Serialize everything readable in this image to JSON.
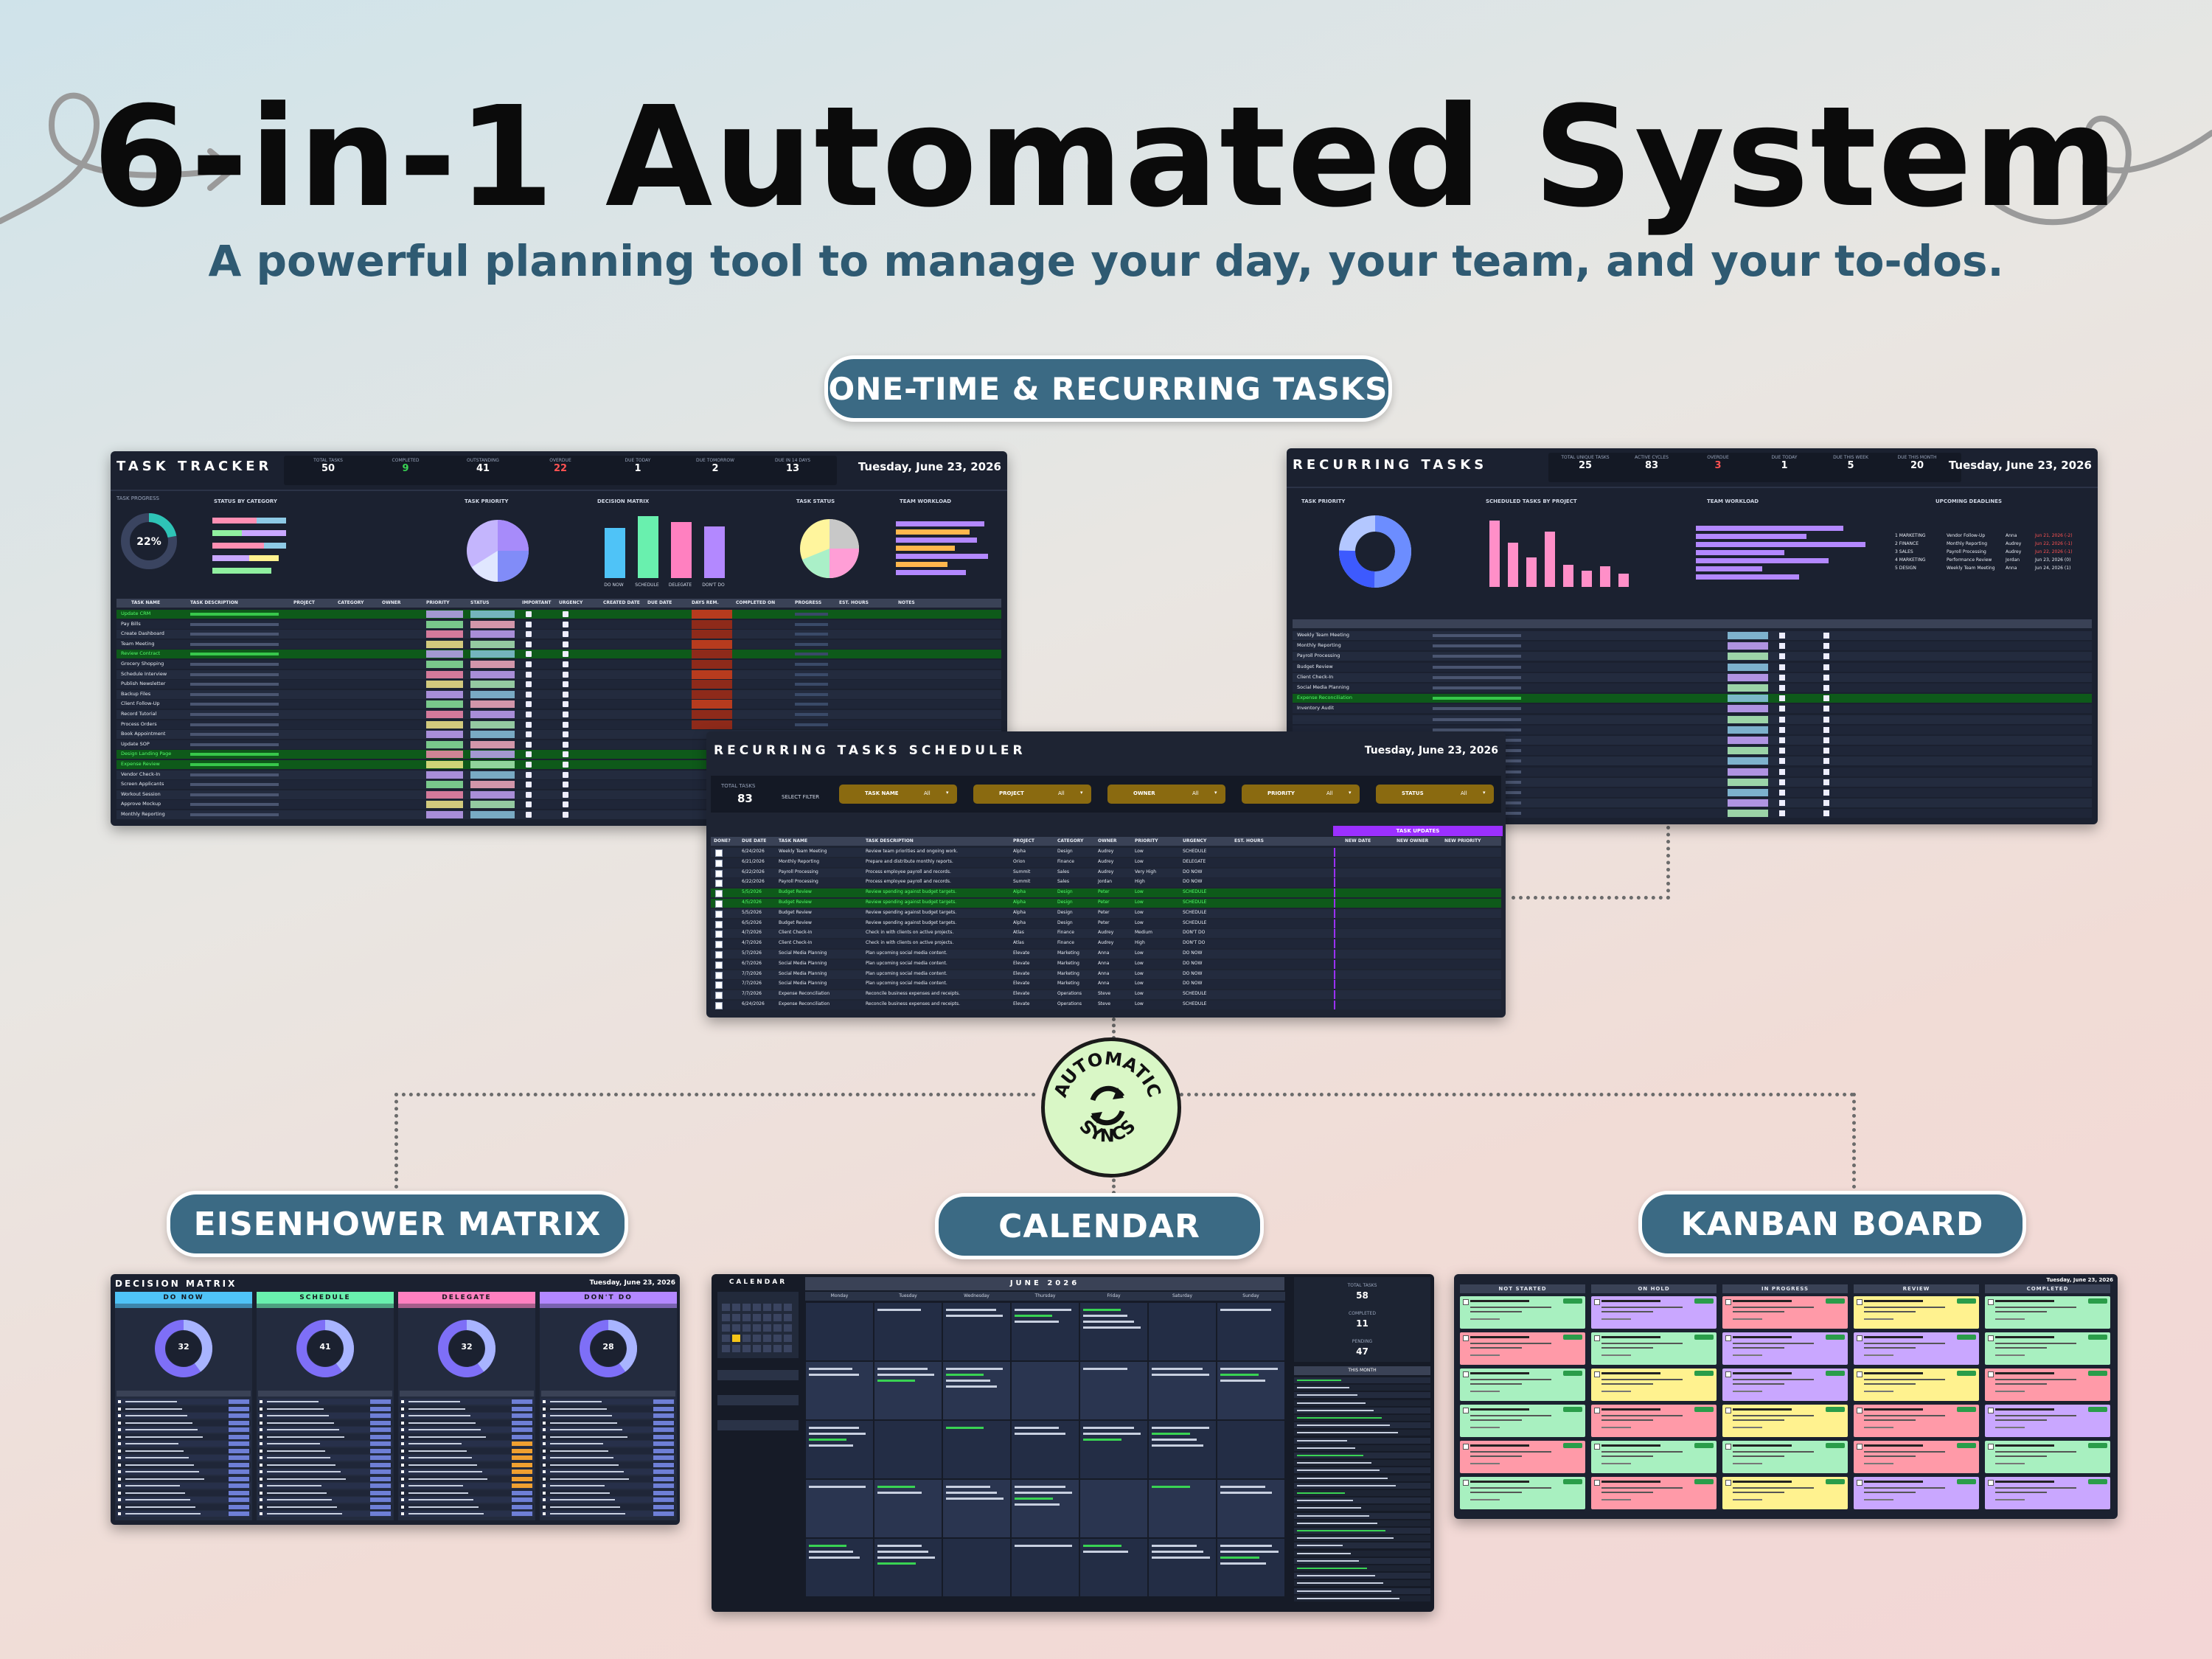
{
  "header": {
    "title": "6-in-1 Automated System",
    "subtitle": "A powerful planning tool to manage your day, your team, and your to-dos."
  },
  "sections": {
    "tasks_pill": "ONE-TIME & RECURRING TASKS",
    "eisenhower_pill": "EISENHOWER MATRIX",
    "calendar_pill": "CALENDAR",
    "kanban_pill": "KANBAN BOARD",
    "sync_badge_top": "AUTOMATIC",
    "sync_badge_bottom": "SYNCS"
  },
  "task_tracker": {
    "title": "TASK TRACKER",
    "date": "Tuesday, June 23, 2026",
    "stats": [
      {
        "label": "TOTAL TASKS",
        "value": "50"
      },
      {
        "label": "COMPLETED",
        "value": "9"
      },
      {
        "label": "OUTSTANDING",
        "value": "41"
      },
      {
        "label": "OVERDUE",
        "value": "22"
      },
      {
        "label": "DUE TODAY",
        "value": "1"
      },
      {
        "label": "DUE TOMORROW",
        "value": "2"
      },
      {
        "label": "DUE IN 14 DAYS",
        "value": "13"
      }
    ],
    "progress_label": "TASK PROGRESS",
    "progress_value": "22%",
    "chart_labels": [
      "STATUS BY CATEGORY",
      "TASK PRIORITY",
      "DECISION MATRIX",
      "TASK STATUS",
      "TEAM WORKLOAD"
    ],
    "matrix_bars": [
      "DO NOW",
      "SCHEDULE",
      "DELEGATE",
      "DON'T DO"
    ],
    "table_headers": [
      "TASK NAME",
      "TASK DESCRIPTION",
      "PROJECT",
      "CATEGORY",
      "OWNER",
      "PRIORITY",
      "STATUS",
      "IMPORTANT",
      "URGENCY",
      "CREATED DATE",
      "DUE DATE",
      "DAYS REM.",
      "COMPLETED ON",
      "PROGRESS",
      "EST. HOURS",
      "NOTES"
    ],
    "rows": [
      "Update CRM",
      "Pay Bills",
      "Create Dashboard",
      "Team Meeting",
      "Review Contract",
      "Grocery Shopping",
      "Schedule Interview",
      "Publish Newsletter",
      "Backup Files",
      "Client Follow-Up",
      "Record Tutorial",
      "Process Orders",
      "Book Appointment",
      "Update SOP",
      "Design Landing Page",
      "Expense Review",
      "Vendor Check-In",
      "Screen Applicants",
      "Workout Session",
      "Approve Mockup",
      "Monthly Reporting"
    ]
  },
  "recurring": {
    "title": "RECURRING TASKS",
    "date": "Tuesday, June 23, 2026",
    "stats": [
      {
        "label": "TOTAL UNIQUE TASKS",
        "value": "25"
      },
      {
        "label": "ACTIVE CYCLES",
        "value": "83"
      },
      {
        "label": "OVERDUE",
        "value": "3"
      },
      {
        "label": "DUE TODAY",
        "value": "1"
      },
      {
        "label": "DUE THIS WEEK",
        "value": "5"
      },
      {
        "label": "DUE THIS MONTH",
        "value": "20"
      }
    ],
    "chart_labels": [
      "TASK PRIORITY",
      "SCHEDULED TASKS BY PROJECT",
      "TEAM WORKLOAD",
      "UPCOMING DEADLINES"
    ],
    "deadlines": [
      {
        "cat": "1 MARKETING",
        "task": "Vendor Follow-Up",
        "owner": "Anna",
        "due": "Jun 21, 2026 (-2)"
      },
      {
        "cat": "2 FINANCE",
        "task": "Monthly Reporting",
        "owner": "Audrey",
        "due": "Jun 22, 2026 (-1)"
      },
      {
        "cat": "3 SALES",
        "task": "Payroll Processing",
        "owner": "Audrey",
        "due": "Jun 22, 2026 (-1)"
      },
      {
        "cat": "4 MARKETING",
        "task": "Performance Review",
        "owner": "Jordan",
        "due": "Jun 23, 2026 (0)"
      },
      {
        "cat": "5 DESIGN",
        "task": "Weekly Team Meeting",
        "owner": "Anna",
        "due": "Jun 24, 2026 (1)"
      }
    ],
    "rows": [
      "Weekly Team Meeting",
      "Monthly Reporting",
      "Payroll Processing",
      "Budget Review",
      "Client Check-In",
      "Social Media Planning",
      "Expense Reconciliation",
      "Inventory Audit"
    ]
  },
  "scheduler": {
    "title": "RECURRING TASKS SCHEDULER",
    "date": "Tuesday, June 23, 2026",
    "total_label": "TOTAL TASKS",
    "total_value": "83",
    "filter_label": "SELECT FILTER",
    "filters": [
      "TASK NAME",
      "PROJECT",
      "OWNER",
      "PRIORITY",
      "STATUS"
    ],
    "filter_value": "All",
    "task_updates": "TASK UPDATES",
    "headers": [
      "DONE?",
      "DUE DATE",
      "TASK NAME",
      "TASK DESCRIPTION",
      "PROJECT",
      "CATEGORY",
      "OWNER",
      "PRIORITY",
      "URGENCY",
      "EST. HOURS",
      "NEW DATE",
      "NEW OWNER",
      "NEW PRIORITY"
    ],
    "rows": [
      {
        "date": "6/24/2026",
        "task": "Weekly Team Meeting",
        "desc": "Review team priorities and ongoing work.",
        "proj": "Alpha",
        "cat": "Design",
        "owner": "Audrey",
        "pri": "Low",
        "urg": "SCHEDULE"
      },
      {
        "date": "6/21/2026",
        "task": "Monthly Reporting",
        "desc": "Prepare and distribute monthly reports.",
        "proj": "Orion",
        "cat": "Finance",
        "owner": "Audrey",
        "pri": "Low",
        "urg": "DELEGATE"
      },
      {
        "date": "6/22/2026",
        "task": "Payroll Processing",
        "desc": "Process employee payroll and records.",
        "proj": "Summit",
        "cat": "Sales",
        "owner": "Audrey",
        "pri": "Very High",
        "urg": "DO NOW"
      },
      {
        "date": "6/22/2026",
        "task": "Payroll Processing",
        "desc": "Process employee payroll and records.",
        "proj": "Summit",
        "cat": "Sales",
        "owner": "Jordan",
        "pri": "High",
        "urg": "DO NOW"
      },
      {
        "date": "5/5/2026",
        "task": "Budget Review",
        "desc": "Review spending against budget targets.",
        "proj": "Alpha",
        "cat": "Design",
        "owner": "Peter",
        "pri": "Low",
        "urg": "SCHEDULE"
      },
      {
        "date": "4/5/2026",
        "task": "Budget Review",
        "desc": "Review spending against budget targets.",
        "proj": "Alpha",
        "cat": "Design",
        "owner": "Peter",
        "pri": "Low",
        "urg": "SCHEDULE"
      },
      {
        "date": "5/5/2026",
        "task": "Budget Review",
        "desc": "Review spending against budget targets.",
        "proj": "Alpha",
        "cat": "Design",
        "owner": "Peter",
        "pri": "Low",
        "urg": "SCHEDULE"
      },
      {
        "date": "6/5/2026",
        "task": "Budget Review",
        "desc": "Review spending against budget targets.",
        "proj": "Alpha",
        "cat": "Design",
        "owner": "Peter",
        "pri": "Low",
        "urg": "SCHEDULE"
      },
      {
        "date": "4/7/2026",
        "task": "Client Check-In",
        "desc": "Check in with clients on active projects.",
        "proj": "Atlas",
        "cat": "Finance",
        "owner": "Audrey",
        "pri": "Medium",
        "urg": "DON'T DO"
      },
      {
        "date": "4/7/2026",
        "task": "Client Check-In",
        "desc": "Check in with clients on active projects.",
        "proj": "Atlas",
        "cat": "Finance",
        "owner": "Audrey",
        "pri": "High",
        "urg": "DON'T DO"
      },
      {
        "date": "5/7/2026",
        "task": "Social Media Planning",
        "desc": "Plan upcoming social media content.",
        "proj": "Elevate",
        "cat": "Marketing",
        "owner": "Anna",
        "pri": "Low",
        "urg": "DO NOW"
      },
      {
        "date": "6/7/2026",
        "task": "Social Media Planning",
        "desc": "Plan upcoming social media content.",
        "proj": "Elevate",
        "cat": "Marketing",
        "owner": "Anna",
        "pri": "Low",
        "urg": "DO NOW"
      },
      {
        "date": "7/7/2026",
        "task": "Social Media Planning",
        "desc": "Plan upcoming social media content.",
        "proj": "Elevate",
        "cat": "Marketing",
        "owner": "Anna",
        "pri": "Low",
        "urg": "DO NOW"
      },
      {
        "date": "7/7/2026",
        "task": "Social Media Planning",
        "desc": "Plan upcoming social media content.",
        "proj": "Elevate",
        "cat": "Marketing",
        "owner": "Anna",
        "pri": "Low",
        "urg": "DO NOW"
      },
      {
        "date": "7/7/2026",
        "task": "Expense Reconciliation",
        "desc": "Reconcile business expenses and receipts.",
        "proj": "Elevate",
        "cat": "Operations",
        "owner": "Steve",
        "pri": "Low",
        "urg": "SCHEDULE"
      },
      {
        "date": "6/24/2026",
        "task": "Expense Reconciliation",
        "desc": "Reconcile business expenses and receipts.",
        "proj": "Elevate",
        "cat": "Operations",
        "owner": "Steve",
        "pri": "Low",
        "urg": "SCHEDULE"
      }
    ]
  },
  "matrix": {
    "title": "DECISION MATRIX",
    "date": "Tuesday, June 23, 2026",
    "quadrants": [
      {
        "name": "DO NOW",
        "count": "32",
        "color": "#4fc3f7"
      },
      {
        "name": "SCHEDULE",
        "count": "41",
        "color": "#69f0ae"
      },
      {
        "name": "DELEGATE",
        "count": "32",
        "color": "#ff80c0"
      },
      {
        "name": "DON'T DO",
        "count": "28",
        "color": "#b388ff"
      }
    ]
  },
  "calendar": {
    "title": "CALENDAR",
    "month": "JUNE 2026",
    "weekdays": [
      "Monday",
      "Tuesday",
      "Wednesday",
      "Thursday",
      "Friday",
      "Saturday",
      "Sunday"
    ],
    "total_label": "TOTAL TASKS",
    "total_value": "58",
    "completed_label": "COMPLETED",
    "completed_value": "11",
    "pending_label": "PENDING",
    "pending_value": "47",
    "this_month": "THIS MONTH"
  },
  "kanban": {
    "date": "Tuesday, June 23, 2026",
    "columns": [
      "NOT STARTED",
      "ON HOLD",
      "IN PROGRESS",
      "REVIEW",
      "COMPLETED"
    ]
  },
  "colors": {
    "accent": "#3b6a84",
    "panel": "#1b2130",
    "green": "#39d353",
    "purple": "#9b59ff"
  }
}
